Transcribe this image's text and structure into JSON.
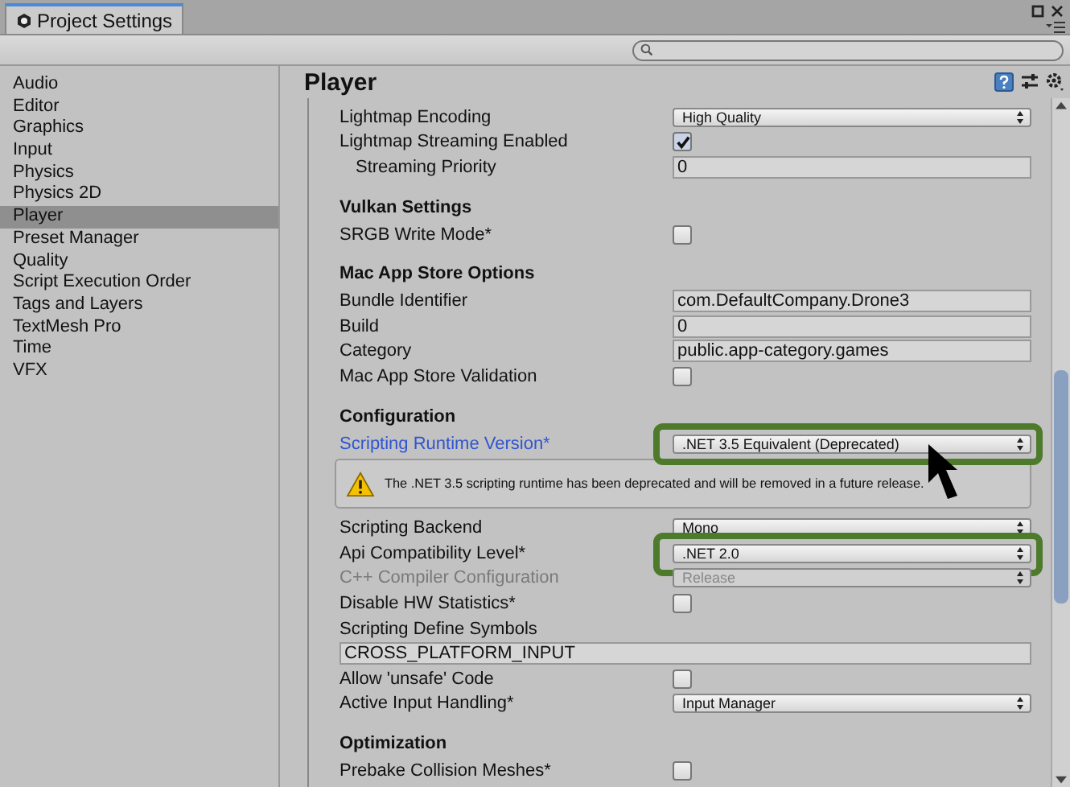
{
  "window": {
    "tab_title": "Project Settings"
  },
  "sidebar": {
    "items": [
      {
        "label": "Audio",
        "selected": false
      },
      {
        "label": "Editor",
        "selected": false
      },
      {
        "label": "Graphics",
        "selected": false
      },
      {
        "label": "Input",
        "selected": false
      },
      {
        "label": "Physics",
        "selected": false
      },
      {
        "label": "Physics 2D",
        "selected": false
      },
      {
        "label": "Player",
        "selected": true
      },
      {
        "label": "Preset Manager",
        "selected": false
      },
      {
        "label": "Quality",
        "selected": false
      },
      {
        "label": "Script Execution Order",
        "selected": false
      },
      {
        "label": "Tags and Layers",
        "selected": false
      },
      {
        "label": "TextMesh Pro",
        "selected": false
      },
      {
        "label": "Time",
        "selected": false
      },
      {
        "label": "VFX",
        "selected": false
      }
    ]
  },
  "panel": {
    "title": "Player",
    "sections": [
      {
        "rows": [
          {
            "kind": "dropdown",
            "label": "Lightmap Encoding",
            "value": "High Quality",
            "disabled": false,
            "highlighted": false,
            "emphasized": false
          },
          {
            "kind": "checkbox",
            "label": "Lightmap Streaming Enabled",
            "checked": true,
            "disabled": false,
            "highlighted": false,
            "emphasized": false,
            "children": [
              {
                "kind": "field",
                "label": "Streaming Priority",
                "value": "0",
                "disabled": false,
                "highlighted": false,
                "emphasized": false
              }
            ]
          }
        ]
      },
      {
        "title": "Vulkan Settings",
        "rows": [
          {
            "kind": "checkbox",
            "label": "SRGB Write Mode*",
            "checked": false,
            "disabled": false,
            "highlighted": false,
            "emphasized": false
          }
        ]
      },
      {
        "title": "Mac App Store Options",
        "rows": [
          {
            "kind": "field",
            "label": "Bundle Identifier",
            "value": "com.DefaultCompany.Drone3",
            "disabled": false,
            "highlighted": false,
            "emphasized": false
          },
          {
            "kind": "field",
            "label": "Build",
            "value": "0",
            "disabled": false,
            "highlighted": false,
            "emphasized": false
          },
          {
            "kind": "field",
            "label": "Category",
            "value": "public.app-category.games",
            "disabled": false,
            "highlighted": false,
            "emphasized": false
          },
          {
            "kind": "checkbox",
            "label": "Mac App Store Validation",
            "checked": false,
            "disabled": false,
            "highlighted": false,
            "emphasized": false
          }
        ]
      },
      {
        "title": "Configuration",
        "rows": [
          {
            "kind": "dropdown",
            "label": "Scripting Runtime Version*",
            "value": ".NET 3.5 Equivalent (Deprecated)",
            "disabled": false,
            "highlighted": true,
            "emphasized": true
          },
          {
            "kind": "warning",
            "text": "The .NET 3.5 scripting runtime has been deprecated and will be removed in a future release."
          },
          {
            "kind": "dropdown",
            "label": "Scripting Backend",
            "value": "Mono",
            "disabled": false,
            "highlighted": false,
            "emphasized": false
          },
          {
            "kind": "dropdown",
            "label": "Api Compatibility Level*",
            "value": ".NET 2.0",
            "disabled": false,
            "highlighted": true,
            "emphasized": false
          },
          {
            "kind": "dropdown",
            "label": "C++ Compiler Configuration",
            "value": "Release",
            "disabled": true,
            "highlighted": false,
            "emphasized": false
          },
          {
            "kind": "checkbox",
            "label": "Disable HW Statistics*",
            "checked": false,
            "disabled": false,
            "highlighted": false,
            "emphasized": false
          },
          {
            "kind": "wide-field",
            "label": "Scripting Define Symbols",
            "value": "CROSS_PLATFORM_INPUT",
            "disabled": false,
            "highlighted": false,
            "emphasized": false
          },
          {
            "kind": "checkbox",
            "label": "Allow 'unsafe' Code",
            "checked": false,
            "disabled": false,
            "highlighted": false,
            "emphasized": false
          },
          {
            "kind": "dropdown",
            "label": "Active Input Handling*",
            "value": "Input Manager",
            "disabled": false,
            "highlighted": false,
            "emphasized": false
          }
        ]
      },
      {
        "title": "Optimization",
        "rows": [
          {
            "kind": "checkbox",
            "label": "Prebake Collision Meshes*",
            "checked": false,
            "disabled": false,
            "highlighted": false,
            "emphasized": false
          }
        ]
      }
    ]
  }
}
